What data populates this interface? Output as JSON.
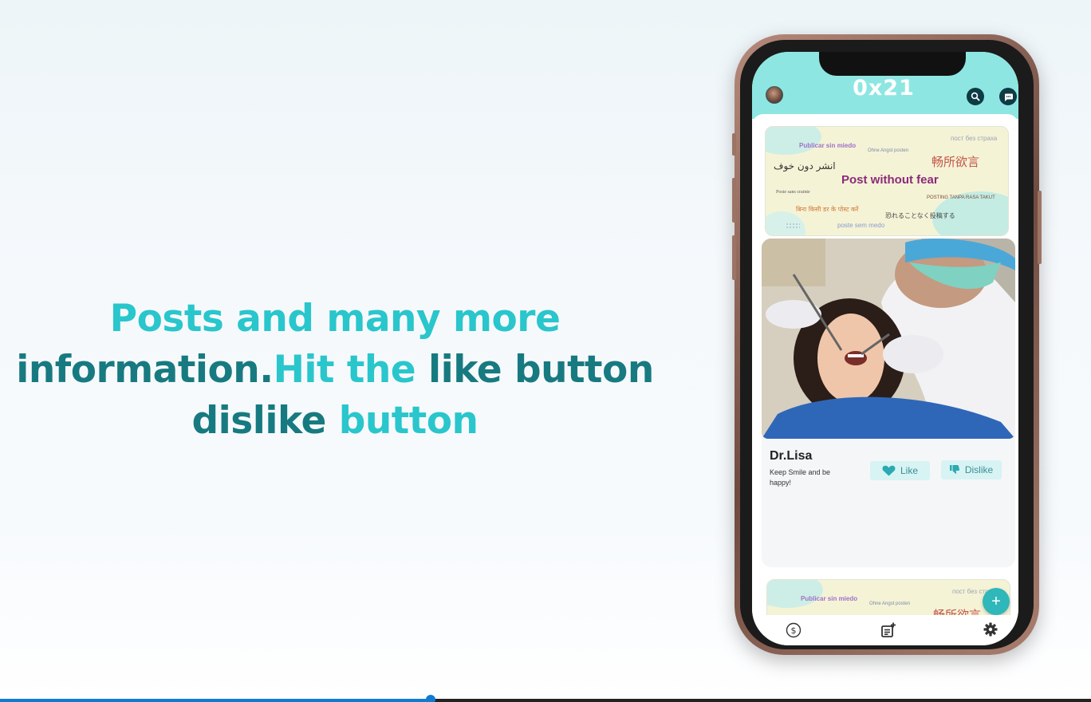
{
  "headline": {
    "line1": "Posts and many more",
    "line2_part1": "information.",
    "line2_part2": "Hit the ",
    "line2_part3": "like button",
    "line3_part1": "dislike ",
    "line3_part2": "button"
  },
  "colors": {
    "accent_light": "#29c6cc",
    "accent_dark": "#177a80",
    "app_header": "#8ee6e2",
    "progress": "#0f7bd3"
  },
  "app": {
    "logo": "0x21",
    "header_icons": [
      "avatar",
      "search-icon",
      "chat-icon"
    ]
  },
  "banner": {
    "main": "Post without fear",
    "es": "Publicar sin miedo",
    "de": "Ohne Angst posten",
    "ru": "пост без страха",
    "zh": "畅所欲言",
    "ar": "انشر دون خوف",
    "fr": "Poste sans crainte",
    "id": "POSTING TANPA RASA TAKUT",
    "hi": "बिना किसी डर के पोस्ट करें",
    "ja": "恐れることなく投稿する",
    "pt": "poste sem medo"
  },
  "post": {
    "author": "Dr.Lisa",
    "caption": "Keep Smile and be happy!",
    "like_label": "Like",
    "dislike_label": "Dislike"
  },
  "fab": {
    "label": "+"
  },
  "bottom_nav": [
    "dollar-icon",
    "new-post-icon",
    "settings-icon"
  ],
  "video": {
    "progress": 0.395
  }
}
